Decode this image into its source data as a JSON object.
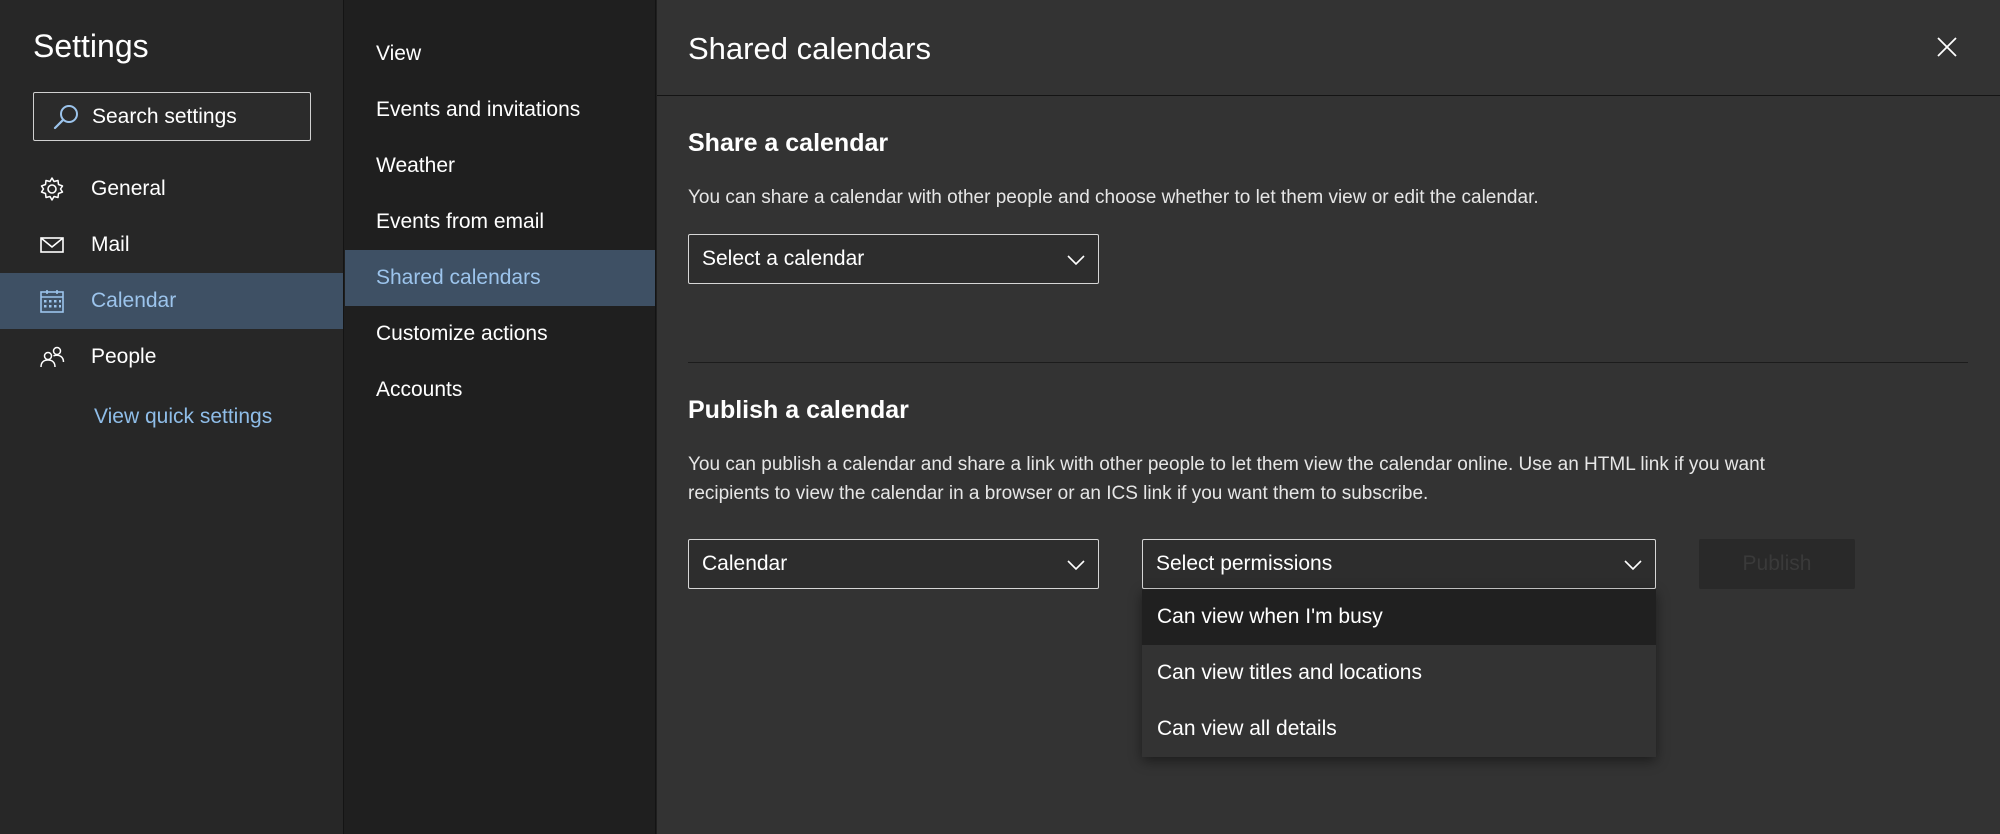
{
  "settings": {
    "title": "Settings",
    "search_placeholder": "Search settings",
    "nav": [
      {
        "label": "General",
        "icon": "gear-icon"
      },
      {
        "label": "Mail",
        "icon": "mail-icon"
      },
      {
        "label": "Calendar",
        "icon": "calendar-icon",
        "active": true
      },
      {
        "label": "People",
        "icon": "people-icon"
      }
    ],
    "quick_settings_label": "View quick settings"
  },
  "categories": [
    {
      "label": "View"
    },
    {
      "label": "Events and invitations"
    },
    {
      "label": "Weather"
    },
    {
      "label": "Events from email"
    },
    {
      "label": "Shared calendars",
      "active": true
    },
    {
      "label": "Customize actions"
    },
    {
      "label": "Accounts"
    }
  ],
  "panel": {
    "title": "Shared calendars",
    "share": {
      "heading": "Share a calendar",
      "description": "You can share a calendar with other people and choose whether to let them view or edit the calendar.",
      "select_label": "Select a calendar"
    },
    "publish": {
      "heading": "Publish a calendar",
      "description_line1": "You can publish a calendar and share a link with other people to let them view the calendar online. Use an HTML link if you want",
      "description_line2": "recipients to view the calendar in a browser or an ICS link if you want them to subscribe.",
      "calendar_select_value": "Calendar",
      "permissions_placeholder": "Select permissions",
      "publish_label": "Publish",
      "permission_options": [
        "Can view when I'm busy",
        "Can view titles and locations",
        "Can view all details"
      ]
    }
  },
  "colors": {
    "accent_bg": "#3e5064",
    "accent_text": "#9cc4ec",
    "link": "#8fbde8"
  }
}
